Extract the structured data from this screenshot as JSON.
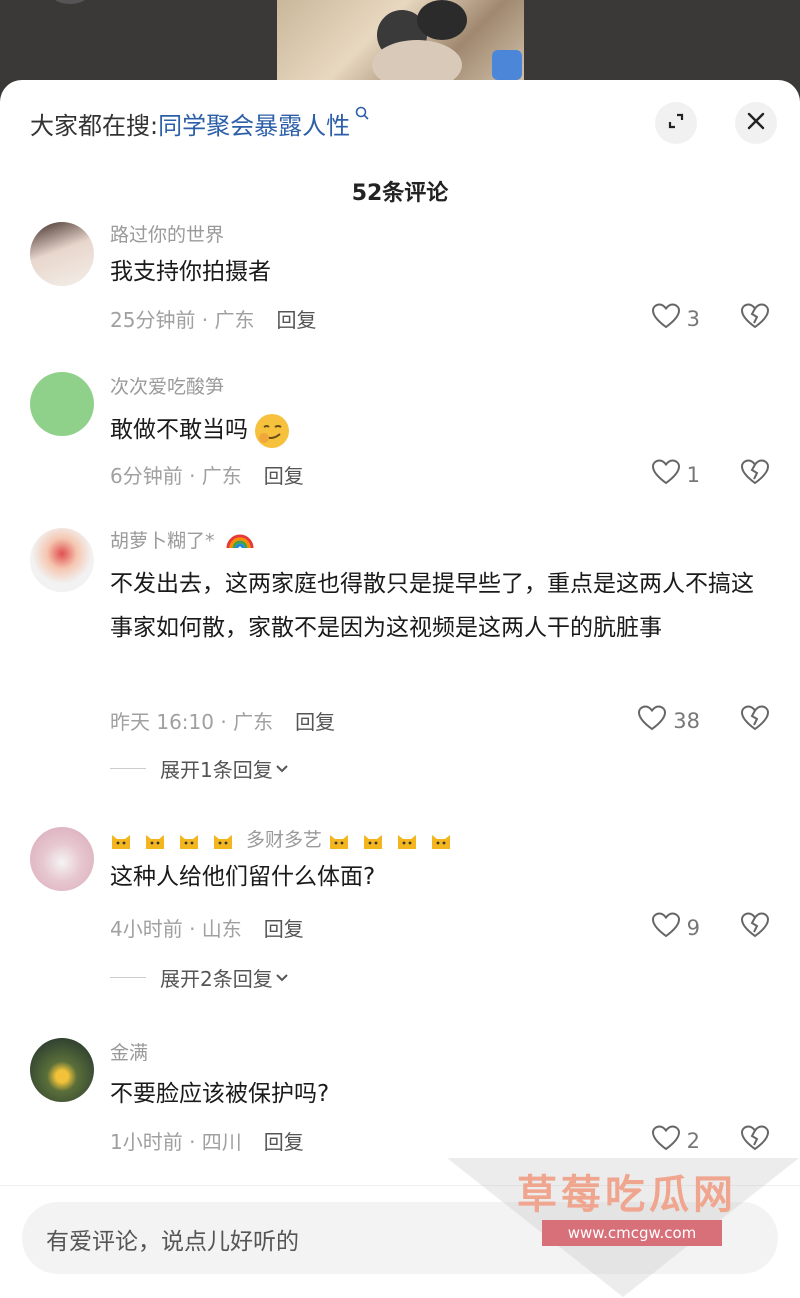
{
  "search": {
    "prefix": "大家都在搜:",
    "term": "同学聚会暴露人性"
  },
  "header": {
    "count": "52条评论"
  },
  "comments": [
    {
      "user": "路过你的世界",
      "text": "我支持你拍摄者",
      "time": "25分钟前 · 广东",
      "reply": "回复",
      "likes": "3"
    },
    {
      "user": "次次爱吃酸笋",
      "text": "敢做不敢当吗",
      "time": "6分钟前 · 广东",
      "reply": "回复",
      "likes": "1"
    },
    {
      "user": "胡萝卜糊了*",
      "text": "不发出去，这两家庭也得散只是提早些了，重点是这两人不搞这事家如何散，家散不是因为这视频是这两人干的肮脏事",
      "time": "昨天 16:10 · 广东",
      "reply": "回复",
      "likes": "38",
      "expand": "展开1条回复"
    },
    {
      "user": "多财多艺",
      "text": "这种人给他们留什么体面?",
      "time": "4小时前 · 山东",
      "reply": "回复",
      "likes": "9",
      "expand": "展开2条回复"
    },
    {
      "user": "金满",
      "text": "不要脸应该被保护吗?",
      "time": "1小时前 · 四川",
      "reply": "回复",
      "likes": "2"
    }
  ],
  "input": {
    "placeholder": "有爱评论，说点儿好听的"
  },
  "watermark": {
    "title": "草莓吃瓜网",
    "url": "www.cmcgw.com"
  },
  "icons": [
    "search-icon",
    "expand-icon",
    "close-icon",
    "heart-icon",
    "broken-heart-icon",
    "chevron-down-icon",
    "cat-emoji-icon",
    "rainbow-emoji-icon",
    "smirk-emoji-icon"
  ]
}
